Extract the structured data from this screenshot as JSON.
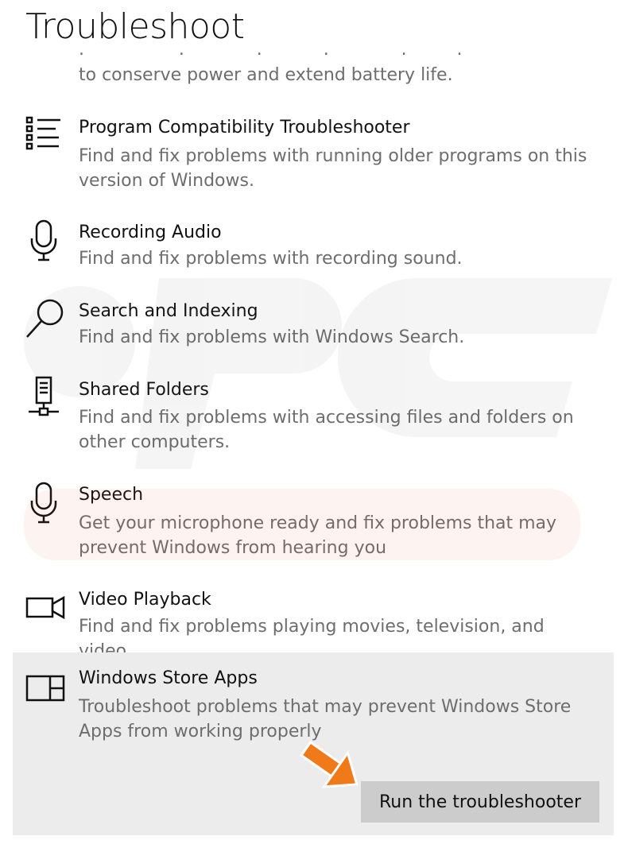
{
  "page": {
    "title": "Troubleshoot"
  },
  "previous_item": {
    "desc_tail": "to conserve power and extend battery life."
  },
  "items": [
    {
      "name": "Program Compatibility Troubleshooter",
      "desc": "Find and fix problems with running older programs on this version of Windows.",
      "icon": "list-icon"
    },
    {
      "name": "Recording Audio",
      "desc": "Find and fix problems with recording sound.",
      "icon": "microphone-icon"
    },
    {
      "name": "Search and Indexing",
      "desc": "Find and fix problems with Windows Search.",
      "icon": "search-icon"
    },
    {
      "name": "Shared Folders",
      "desc": "Find and fix problems with accessing files and folders on other computers.",
      "icon": "network-drive-icon"
    },
    {
      "name": "Speech",
      "desc": "Get your microphone ready and fix problems that may prevent Windows from hearing you",
      "icon": "microphone-icon"
    },
    {
      "name": "Video Playback",
      "desc": "Find and fix problems playing movies, television, and video",
      "icon": "video-camera-icon"
    },
    {
      "name": "Windows Store Apps",
      "desc": "Troubleshoot problems that may prevent Windows Store Apps from working properly",
      "icon": "store-apps-icon",
      "selected": true
    }
  ],
  "run_button": {
    "label": "Run the troubleshooter"
  },
  "colors": {
    "selected_background": "#ececec",
    "button_background": "#cccccc",
    "secondary_text": "#6d6d6d",
    "arrow": "#f07a1a"
  }
}
